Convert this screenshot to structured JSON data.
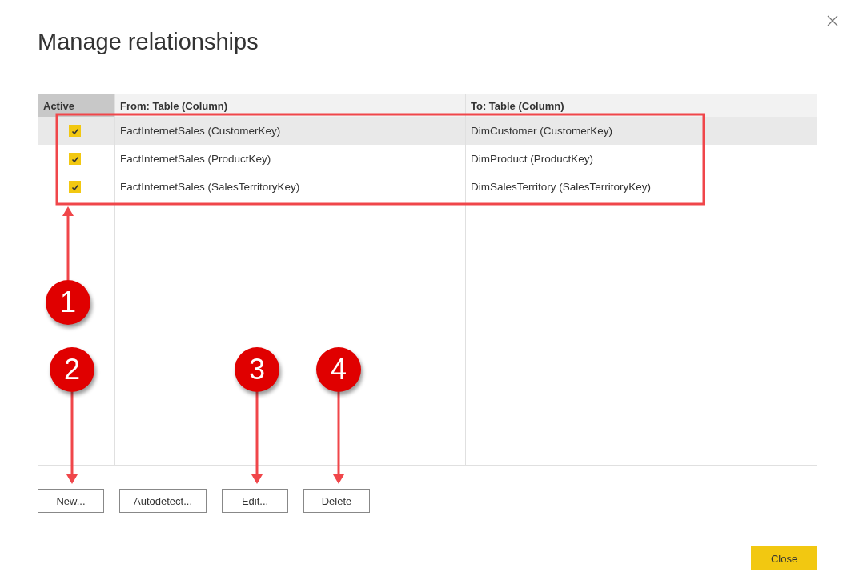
{
  "dialog": {
    "title": "Manage relationships"
  },
  "table": {
    "columns": [
      "Active",
      "From: Table (Column)",
      "To: Table (Column)"
    ],
    "rows": [
      {
        "active": true,
        "from": "FactInternetSales (CustomerKey)",
        "to": "DimCustomer (CustomerKey)",
        "selected": true
      },
      {
        "active": true,
        "from": "FactInternetSales (ProductKey)",
        "to": "DimProduct (ProductKey)",
        "selected": false
      },
      {
        "active": true,
        "from": "FactInternetSales (SalesTerritoryKey)",
        "to": "DimSalesTerritory (SalesTerritoryKey)",
        "selected": false
      }
    ]
  },
  "buttons": [
    "New...",
    "Autodetect...",
    "Edit...",
    "Delete"
  ],
  "close_button": "Close",
  "callouts": [
    {
      "label": "1",
      "kind": "up"
    },
    {
      "label": "2",
      "kind": "down"
    },
    {
      "label": "3",
      "kind": "down"
    },
    {
      "label": "4",
      "kind": "down"
    }
  ]
}
